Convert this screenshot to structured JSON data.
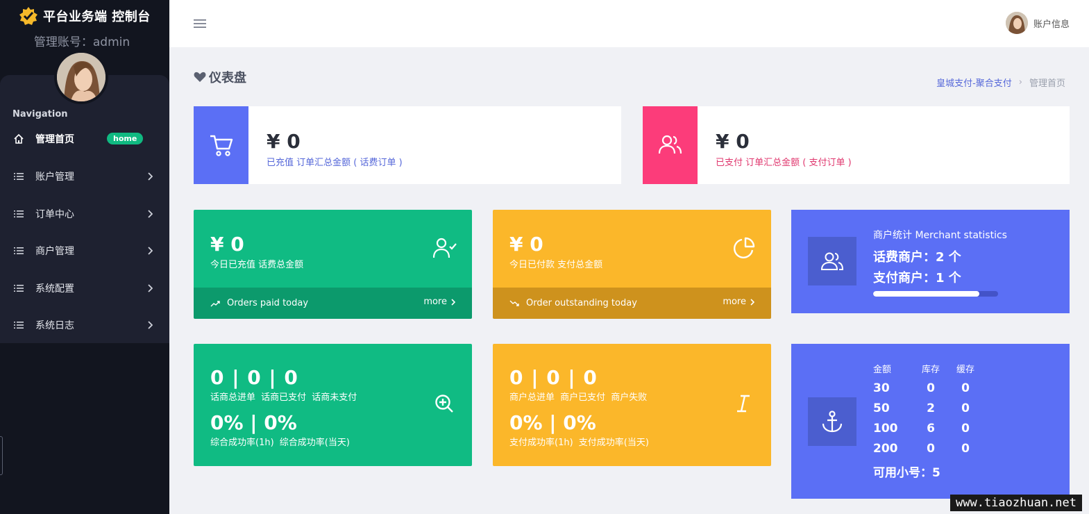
{
  "brand": {
    "title": "平台业务端 控制台",
    "account_line": "管理账号：admin"
  },
  "sidebar": {
    "heading": "Navigation",
    "items": [
      {
        "label": "管理首页",
        "badge": "home"
      },
      {
        "label": "账户管理"
      },
      {
        "label": "订单中心"
      },
      {
        "label": "商户管理"
      },
      {
        "label": "系统配置"
      },
      {
        "label": "系统日志"
      }
    ]
  },
  "header": {
    "user_label": "账户信息"
  },
  "page": {
    "title": "仪表盘",
    "breadcrumb": [
      "皇城支付-聚合支付",
      "管理首页"
    ]
  },
  "summary": [
    {
      "value": "¥ 0",
      "desc": "已充值 订单汇总金额 ( 话费订单 )",
      "color": "#5b6ff5",
      "desc_color": "#5567d9",
      "icon": "cart-icon"
    },
    {
      "value": "¥ 0",
      "desc": "已支付 订单汇总金额 ( 支付订单 )",
      "color": "#fc3c7a",
      "desc_color": "#e0386f",
      "icon": "users-icon"
    }
  ],
  "today": [
    {
      "value": "¥ 0",
      "label": "今日已充值 话费总金额",
      "foot": "Orders paid today",
      "more": "more"
    },
    {
      "value": "¥ 0",
      "label": "今日已付款 支付总金额",
      "foot": "Order outstanding today",
      "more": "more"
    }
  ],
  "merchant": {
    "title": "商户统计 Merchant statistics",
    "line1": "话费商户：2 个",
    "line2": "支付商户：1 个",
    "bar_fraction": 0.85
  },
  "call_stats": {
    "nums": "0 | 0 | 0",
    "labels": "话商总进单 话商已支付 话商未支付",
    "pcts": "0% | 0%",
    "pct_labels": "综合成功率(1h) 综合成功率(当天)"
  },
  "pay_stats": {
    "nums": "0 | 0 | 0",
    "labels": "商户总进单 商户已支付 商户失败",
    "pcts": "0% | 0%",
    "pct_labels": "支付成功率(1h) 支付成功率(当天)"
  },
  "stock": {
    "headers": [
      "金额",
      "库存",
      "缓存"
    ],
    "rows": [
      [
        "30",
        "0",
        "0"
      ],
      [
        "50",
        "2",
        "0"
      ],
      [
        "100",
        "6",
        "0"
      ],
      [
        "200",
        "0",
        "0"
      ]
    ],
    "available": "可用小号：5"
  },
  "watermark": "www.tiaozhuan.net"
}
